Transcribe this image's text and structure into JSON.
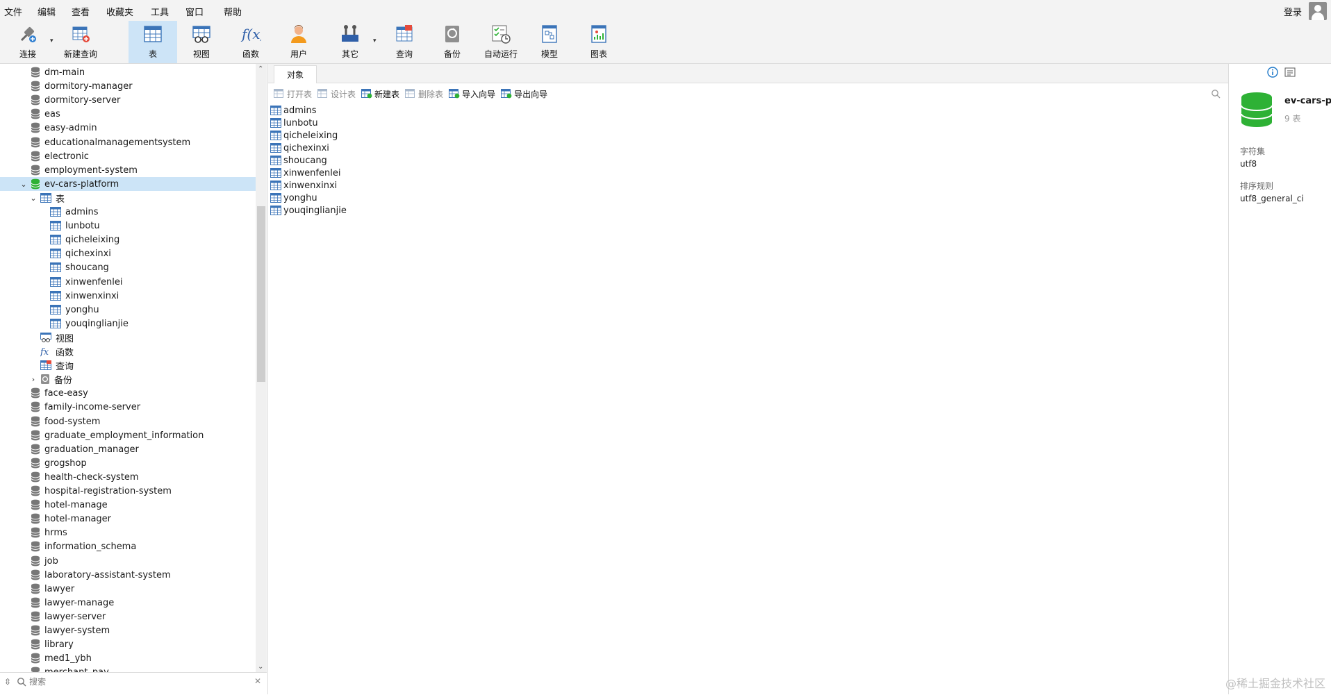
{
  "menu": [
    "文件",
    "编辑",
    "查看",
    "收藏夹",
    "工具",
    "窗口",
    "帮助"
  ],
  "login_label": "登录",
  "toolbar": [
    {
      "label": "连接",
      "icon": "connection-icon",
      "caret": true
    },
    {
      "label": "新建查询",
      "icon": "new-query-icon"
    },
    {
      "label": "表",
      "icon": "table-icon",
      "active": true
    },
    {
      "label": "视图",
      "icon": "view-icon"
    },
    {
      "label": "函数",
      "icon": "function-icon"
    },
    {
      "label": "用户",
      "icon": "user-icon"
    },
    {
      "label": "其它",
      "icon": "other-tools-icon",
      "caret": true
    },
    {
      "label": "查询",
      "icon": "query-icon"
    },
    {
      "label": "备份",
      "icon": "backup-icon"
    },
    {
      "label": "自动运行",
      "icon": "auto-run-icon"
    },
    {
      "label": "模型",
      "icon": "model-icon"
    },
    {
      "label": "图表",
      "icon": "chart-icon"
    }
  ],
  "tree": {
    "databases_before": [
      "dm-main",
      "dormitory-manager",
      "dormitory-server",
      "eas",
      "easy-admin",
      "educationalmanagementsystem",
      "electronic",
      "employment-system"
    ],
    "open_db": "ev-cars-platform",
    "tables_node": "表",
    "tables": [
      "admins",
      "lunbotu",
      "qicheleixing",
      "qichexinxi",
      "shoucang",
      "xinwenfenlei",
      "xinwenxinxi",
      "yonghu",
      "youqinglianjie"
    ],
    "views_node": "视图",
    "functions_node": "函数",
    "queries_node": "查询",
    "backups_node": "备份",
    "databases_after": [
      "face-easy",
      "family-income-server",
      "food-system",
      "graduate_employment_information",
      "graduation_manager",
      "grogshop",
      "health-check-system",
      "hospital-registration-system",
      "hotel-manage",
      "hotel-manager",
      "hrms",
      "information_schema",
      "job",
      "laboratory-assistant-system",
      "lawyer",
      "lawyer-manage",
      "lawyer-server",
      "lawyer-system",
      "library",
      "med1_ybh",
      "merchant_pay"
    ],
    "search_placeholder": "搜索"
  },
  "main": {
    "tab": "对象",
    "actions": [
      {
        "label": "打开表",
        "icon": "open-table-icon",
        "enabled": false
      },
      {
        "label": "设计表",
        "icon": "design-table-icon",
        "enabled": false
      },
      {
        "label": "新建表",
        "icon": "new-table-icon",
        "enabled": true
      },
      {
        "label": "删除表",
        "icon": "delete-table-icon",
        "enabled": false
      },
      {
        "label": "导入向导",
        "icon": "import-wizard-icon",
        "enabled": true
      },
      {
        "label": "导出向导",
        "icon": "export-wizard-icon",
        "enabled": true
      }
    ],
    "objects": [
      "admins",
      "lunbotu",
      "qicheleixing",
      "qichexinxi",
      "shoucang",
      "xinwenfenlei",
      "xinwenxinxi",
      "yonghu",
      "youqinglianjie"
    ]
  },
  "info": {
    "name": "ev-cars-p",
    "count": "9 表",
    "charset_label": "字符集",
    "charset": "utf8",
    "collation_label": "排序规则",
    "collation": "utf8_general_ci"
  },
  "watermark": "@稀土掘金技术社区",
  "colors": {
    "db_green": "#2eb135",
    "db_gray": "#777777",
    "accent": "#1e78c8",
    "selected": "#cce4f7"
  }
}
